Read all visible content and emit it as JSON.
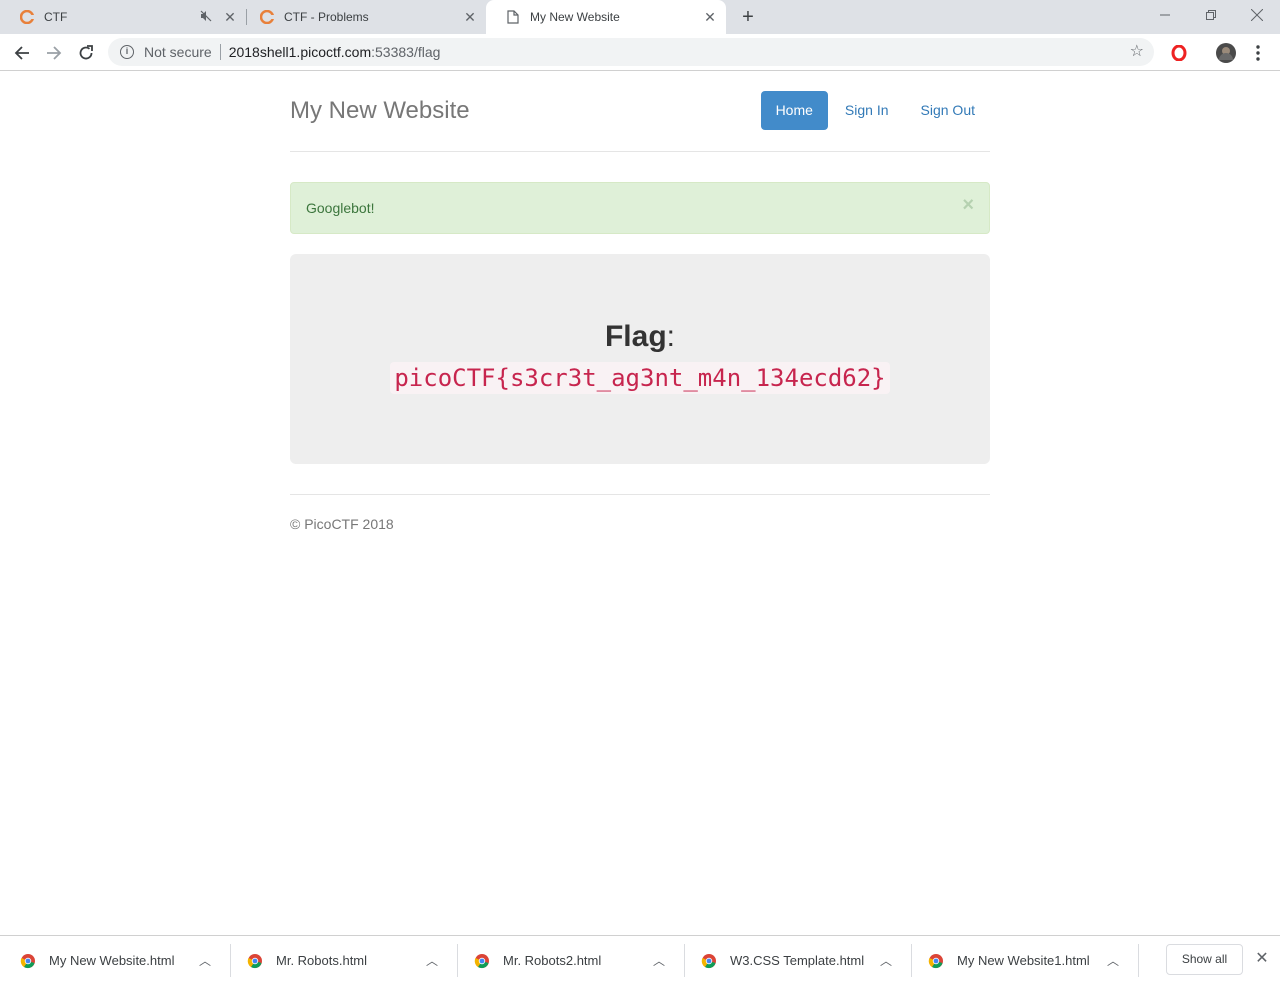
{
  "browser": {
    "tabs": [
      {
        "title": "CTF",
        "muted": true,
        "active": false
      },
      {
        "title": "CTF - Problems",
        "active": false
      },
      {
        "title": "My New Website",
        "active": true
      }
    ],
    "new_tab_label": "+",
    "url": {
      "security_label": "Not secure",
      "host": "2018shell1.picoctf.com",
      "path": ":53383/flag"
    }
  },
  "site": {
    "brand": "My New Website",
    "nav": [
      {
        "label": "Home",
        "active": true
      },
      {
        "label": "Sign In",
        "active": false
      },
      {
        "label": "Sign Out",
        "active": false
      }
    ],
    "alert": {
      "message": "Googlebot!",
      "close": "×"
    },
    "flag": {
      "heading": "Flag",
      "colon": ":",
      "value": "picoCTF{s3cr3t_ag3nt_m4n_134ecd62}"
    },
    "footer": "© PicoCTF 2018"
  },
  "downloads": {
    "items": [
      {
        "name": "My New Website.html"
      },
      {
        "name": "Mr. Robots.html"
      },
      {
        "name": "Mr. Robots2.html"
      },
      {
        "name": "W3.CSS Template.html"
      },
      {
        "name": "My New Website1.html"
      }
    ],
    "show_all": "Show all"
  },
  "colors": {
    "nav_active_bg": "#428bca",
    "alert_bg": "#dff0d8",
    "alert_text": "#3c763d",
    "flag_code_text": "#c7254e"
  }
}
